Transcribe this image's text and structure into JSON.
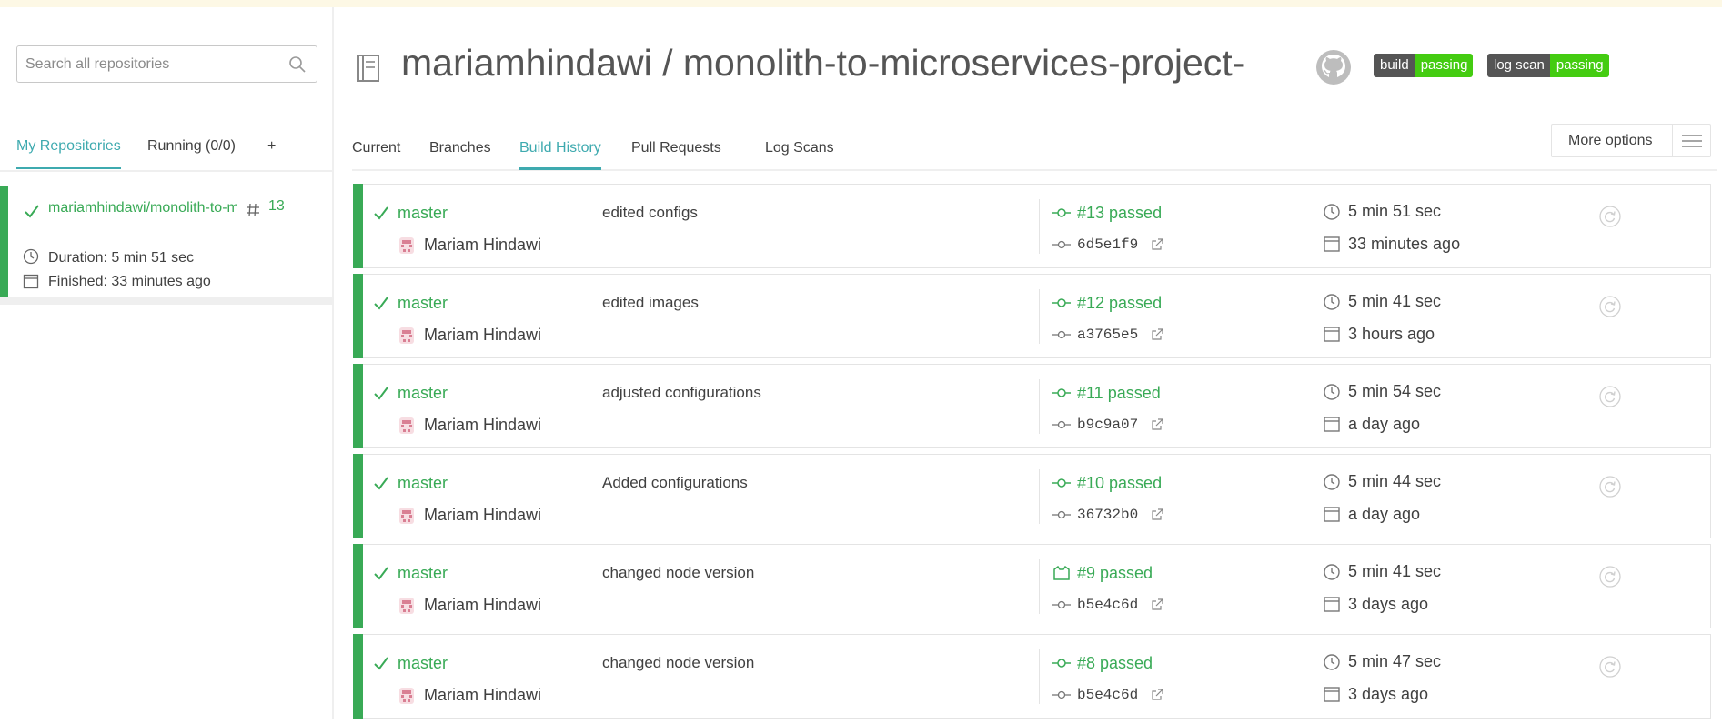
{
  "sidebar": {
    "search_placeholder": "Search all repositories",
    "tabs": [
      {
        "label": "My Repositories",
        "active": true
      },
      {
        "label": "Running (0/0)",
        "active": false
      },
      {
        "label": "+",
        "active": false
      }
    ],
    "repo": {
      "name": "mariamhindawi/monolith-to-microservices-project-",
      "build_number": "13",
      "duration": "Duration: 5 min 51 sec",
      "finished": "Finished: 33 minutes ago",
      "status_color": "#39aa56"
    }
  },
  "header": {
    "title": "mariamhindawi / monolith-to-microservices-project-",
    "badges": [
      {
        "left": "build",
        "right": "passing"
      },
      {
        "left": "log scan",
        "right": "passing"
      }
    ]
  },
  "tabs": [
    {
      "label": "Current",
      "active": false
    },
    {
      "label": "Branches",
      "active": false
    },
    {
      "label": "Build History",
      "active": true
    },
    {
      "label": "Pull Requests",
      "active": false
    },
    {
      "label": "Log Scans",
      "active": false
    }
  ],
  "more_options": "More options",
  "builds": [
    {
      "branch": "master",
      "author": "Mariam Hindawi",
      "message": "edited configs",
      "number": "#13 passed",
      "commit": "6d5e1f9",
      "duration": "5 min 51 sec",
      "finished": "33 minutes ago",
      "kind": "push"
    },
    {
      "branch": "master",
      "author": "Mariam Hindawi",
      "message": "edited images",
      "number": "#12 passed",
      "commit": "a3765e5",
      "duration": "5 min 41 sec",
      "finished": "3 hours ago",
      "kind": "push"
    },
    {
      "branch": "master",
      "author": "Mariam Hindawi",
      "message": "adjusted configurations",
      "number": "#11 passed",
      "commit": "b9c9a07",
      "duration": "5 min 54 sec",
      "finished": "a day ago",
      "kind": "push"
    },
    {
      "branch": "master",
      "author": "Mariam Hindawi",
      "message": "Added configurations",
      "number": "#10 passed",
      "commit": "36732b0",
      "duration": "5 min 44 sec",
      "finished": "a day ago",
      "kind": "push"
    },
    {
      "branch": "master",
      "author": "Mariam Hindawi",
      "message": "changed node version",
      "number": "#9 passed",
      "commit": "b5e4c6d",
      "duration": "5 min 41 sec",
      "finished": "3 days ago",
      "kind": "api"
    },
    {
      "branch": "master",
      "author": "Mariam Hindawi",
      "message": "changed node version",
      "number": "#8 passed",
      "commit": "b5e4c6d",
      "duration": "5 min 47 sec",
      "finished": "3 days ago",
      "kind": "push"
    }
  ],
  "colors": {
    "passed": "#39aa56",
    "accent": "#3eaaaf",
    "badge_left": "#555555",
    "badge_right": "#44cc11"
  }
}
